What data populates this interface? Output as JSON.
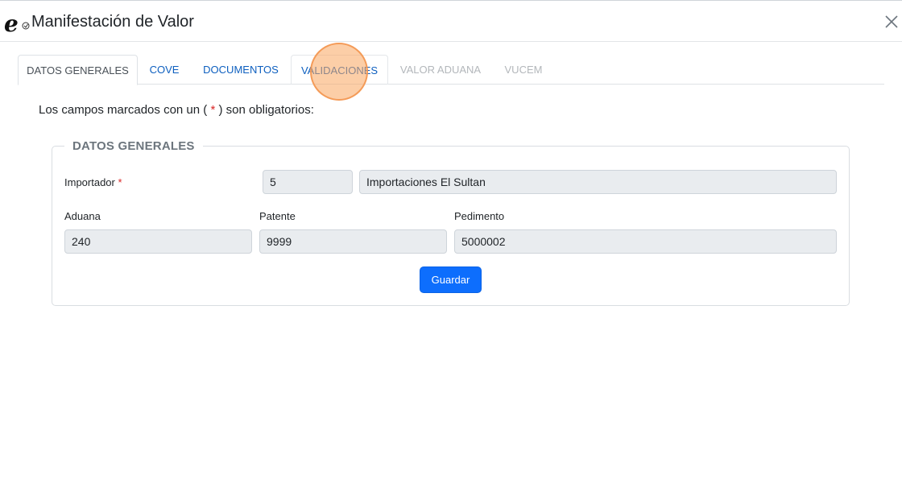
{
  "window": {
    "title": "Manifestación de Valor",
    "logo_icon": "e-logo-icon",
    "close_icon": "close-icon"
  },
  "tabs": [
    {
      "label": "DATOS GENERALES",
      "state": "active"
    },
    {
      "label": "COVE",
      "state": "enabled"
    },
    {
      "label": "DOCUMENTOS",
      "state": "enabled"
    },
    {
      "label": "VALIDACIONES",
      "state": "hovered"
    },
    {
      "label": "VALOR ADUANA",
      "state": "disabled"
    },
    {
      "label": "VUCEM",
      "state": "disabled"
    }
  ],
  "notice": {
    "prefix": "Los campos marcados con un (",
    "star": "*",
    "suffix": ") son obligatorios:"
  },
  "form": {
    "legend": "DATOS GENERALES",
    "importador": {
      "label": "Importador",
      "required_mark": "*",
      "code": "5",
      "name": "Importaciones El Sultan"
    },
    "aduana": {
      "label": "Aduana",
      "value": "240"
    },
    "patente": {
      "label": "Patente",
      "value": "9999"
    },
    "pedimento": {
      "label": "Pedimento",
      "value": "5000002"
    },
    "save_label": "Guardar"
  },
  "colors": {
    "link": "#0d5fbf",
    "primary_button": "#0d6efd",
    "required": "#d92626",
    "readonly_field": "#e9ecef",
    "click_marker": "#f4a261"
  }
}
